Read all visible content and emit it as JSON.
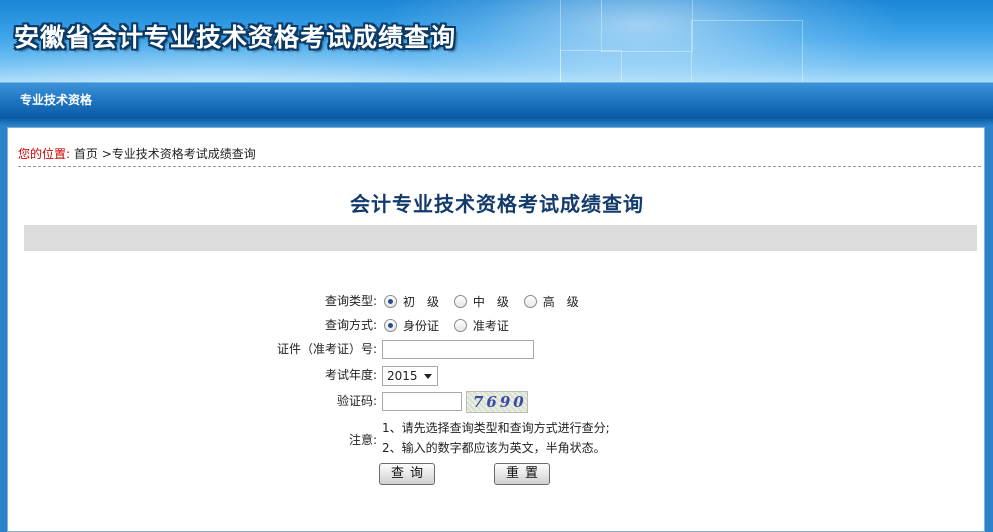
{
  "header": {
    "title": "安徽省会计专业技术资格考试成绩查询"
  },
  "nav": {
    "items": [
      {
        "label": "专业技术资格"
      }
    ]
  },
  "breadcrumb": {
    "label": "您的位置:",
    "home": "首页",
    "current": ">专业技术资格考试成绩查询"
  },
  "page": {
    "title": "会计专业技术资格考试成绩查询"
  },
  "form": {
    "query_type": {
      "label": "查询类型:",
      "options": [
        "初　级",
        "中　级",
        "高　级"
      ],
      "selected": "初　级"
    },
    "query_method": {
      "label": "查询方式:",
      "options": [
        "身份证",
        "准考证"
      ],
      "selected": "身份证"
    },
    "id_number": {
      "label": "证件（准考证）号:",
      "value": ""
    },
    "exam_year": {
      "label": "考试年度:",
      "value": "2015"
    },
    "captcha": {
      "label": "验证码:",
      "value": "",
      "image_text": "7690"
    },
    "notes": {
      "label": "注意:",
      "lines": [
        "1、请先选择查询类型和查询方式进行查分;",
        "2、输入的数字都应该为英文，半角状态。"
      ]
    },
    "buttons": {
      "query": "查询",
      "reset": "重置"
    }
  }
}
